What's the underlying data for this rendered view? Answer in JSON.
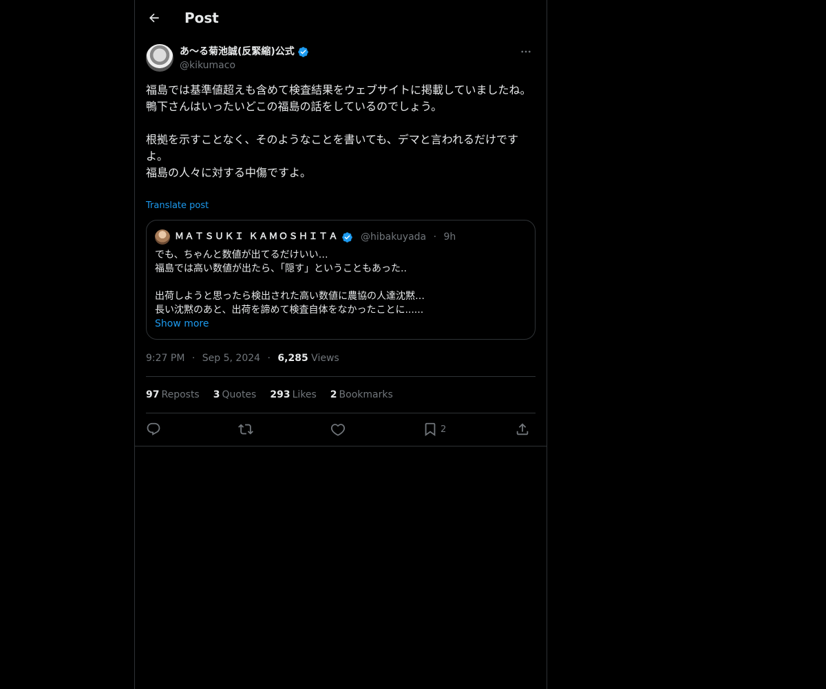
{
  "header": {
    "title": "Post"
  },
  "post": {
    "author_name": "あ〜る菊池誠(反緊縮)公式",
    "author_handle": "@kikumaco",
    "text": "福島では基準値超えも含めて検査結果をウェブサイトに掲載していましたね。\n鴨下さんはいったいどこの福島の話をしているのでしょう。\n\n根拠を示すことなく、そのようなことを書いても、デマと言われるだけですよ。\n福島の人々に対する中傷ですよ。",
    "translate_label": "Translate post",
    "time": "9:27 PM",
    "date": "Sep 5, 2024",
    "views_count": "6,285",
    "views_label": "Views"
  },
  "quote": {
    "author_name": "ＭＡＴＳＵＫＩ ＫＡＭＯＳＨＩＴＡ",
    "handle": "@hibakuyada",
    "age": "9h",
    "text": "でも、ちゃんと数値が出てるだけいい…\n福島では高い数値が出たら、「隠す」ということもあった..\n\n出荷しようと思ったら検出された高い数値に農協の人達沈黙…\n長い沈黙のあと、出荷を諦めて検査自体をなかったことに......",
    "show_more": "Show more"
  },
  "stats": {
    "reposts_count": "97",
    "reposts_label": "Reposts",
    "quotes_count": "3",
    "quotes_label": "Quotes",
    "likes_count": "293",
    "likes_label": "Likes",
    "bookmarks_count": "2",
    "bookmarks_label": "Bookmarks"
  },
  "actions": {
    "bookmark_count": "2"
  },
  "icons": {
    "back": "arrow-left-icon",
    "verified": "verified-badge-icon",
    "more": "more-horizontal-icon",
    "reply": "reply-icon",
    "repost": "repost-icon",
    "like": "heart-icon",
    "bookmark": "bookmark-icon",
    "share": "share-icon"
  },
  "colors": {
    "background": "#000000",
    "text": "#e7e9ea",
    "secondary": "#71767b",
    "accent": "#1d9bf0",
    "border": "#2f3336"
  }
}
